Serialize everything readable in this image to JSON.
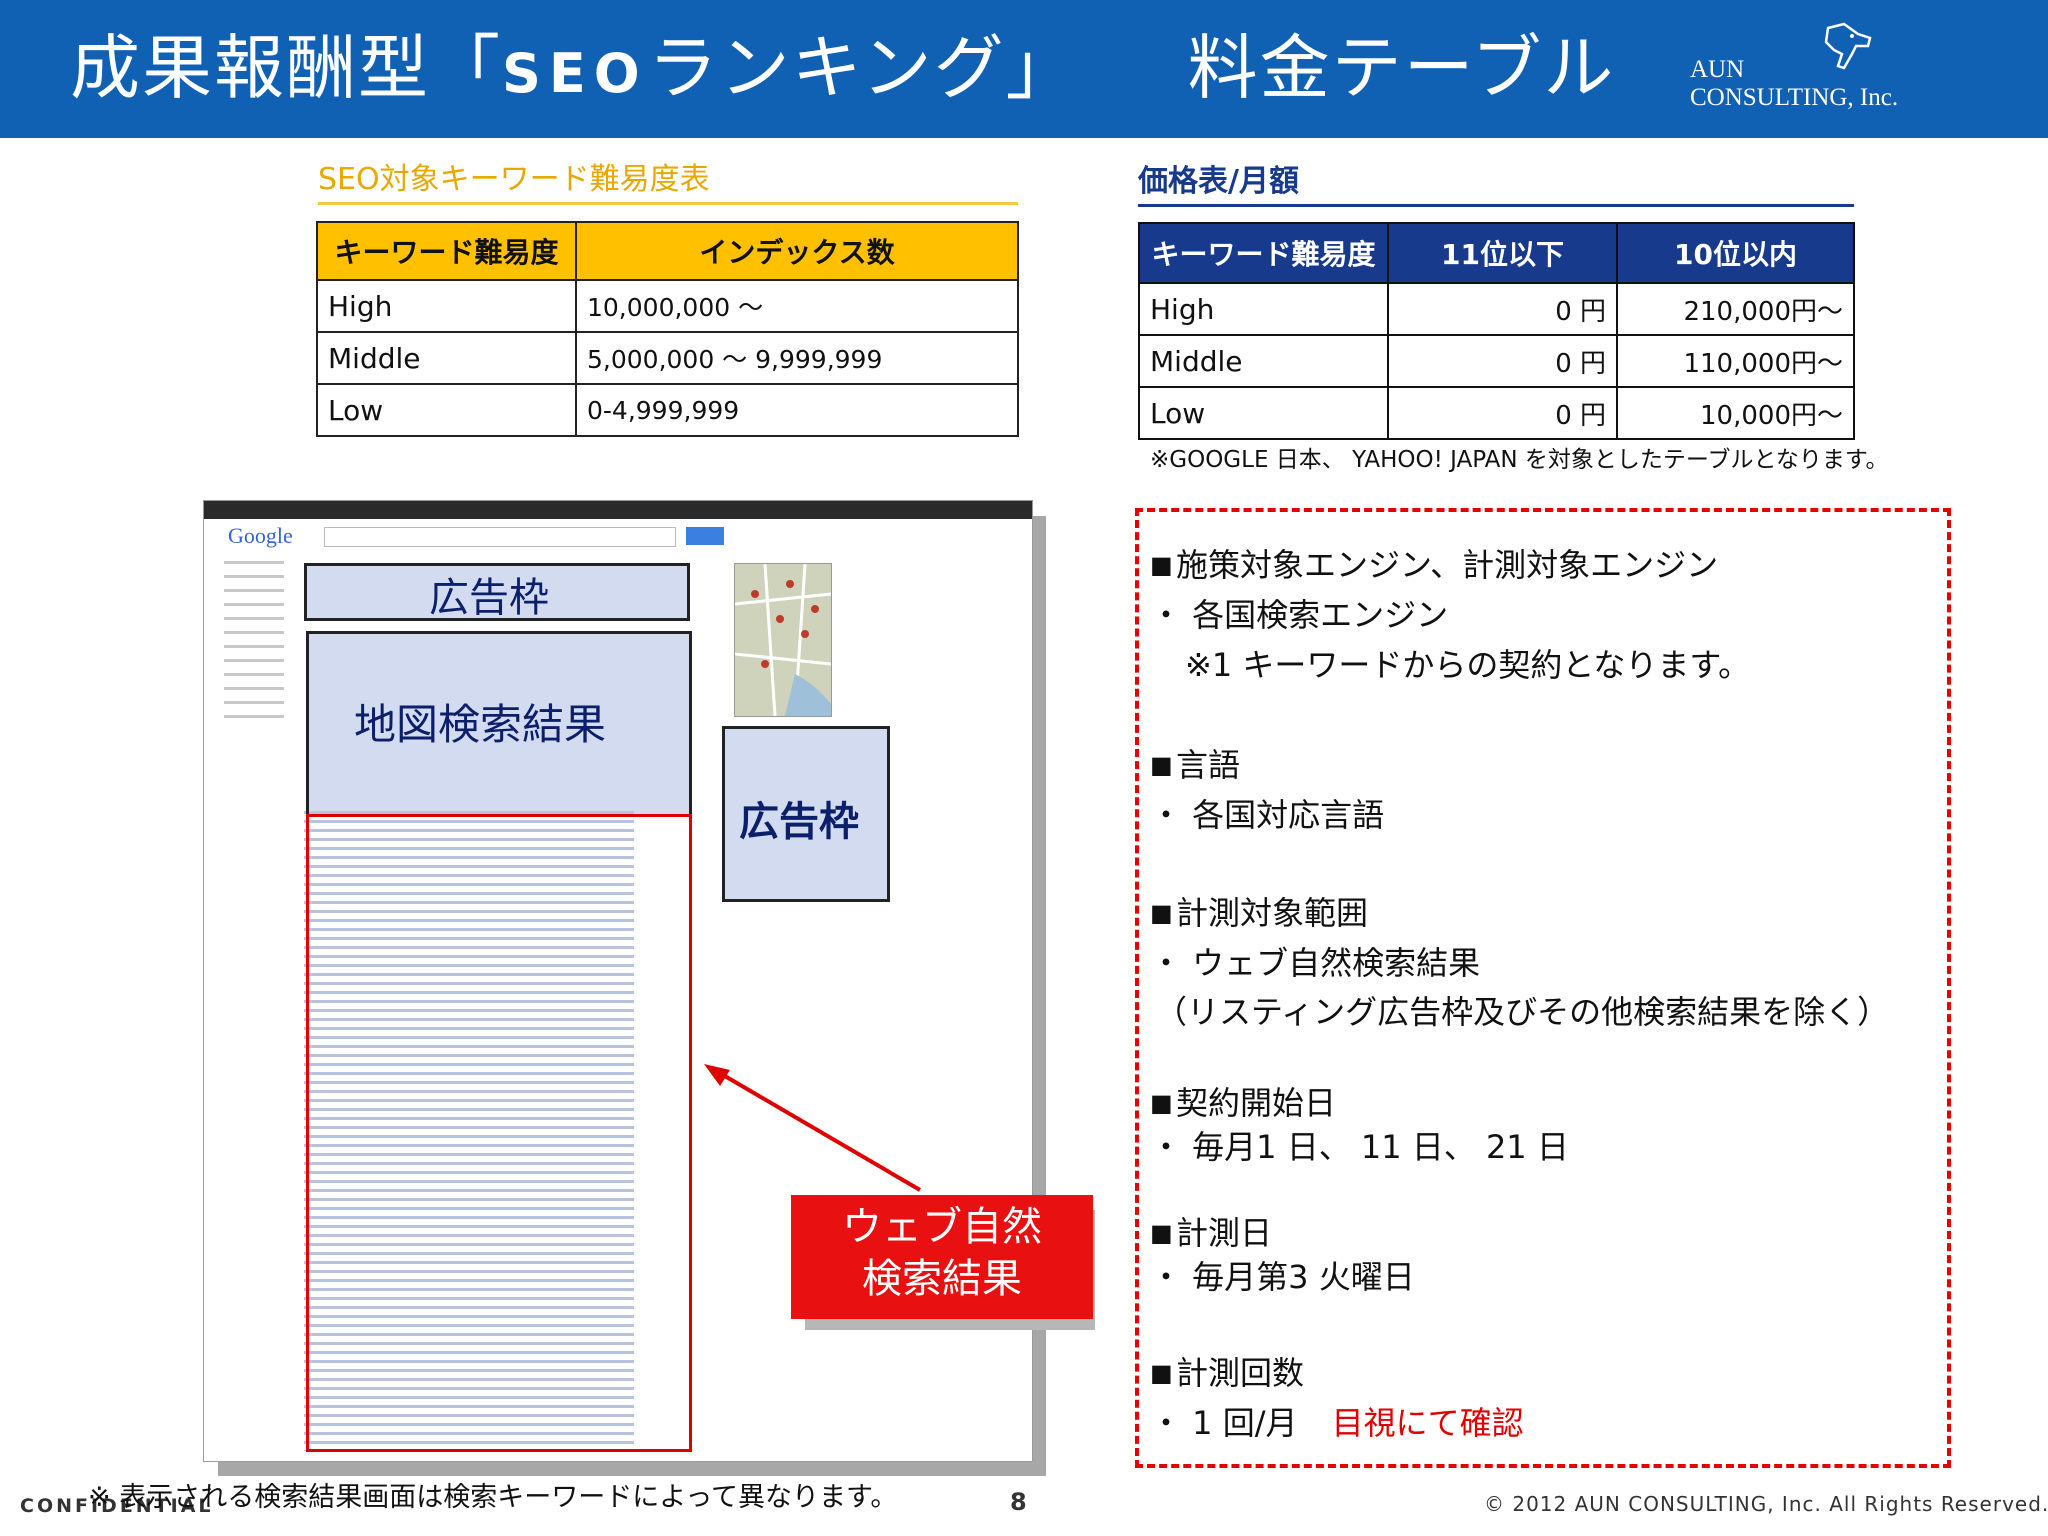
{
  "header": {
    "title_pre": "成果報酬型「",
    "title_seo": "SEO",
    "title_post": "ランキング」",
    "title_right": "料金テーブル",
    "logo_line1": "AUN",
    "logo_line2": "CONSULTING, Inc.",
    "bg_color": "#1060b4"
  },
  "keyword_table": {
    "heading": "SEO対象キーワード難易度表",
    "columns": [
      "キーワード難易度",
      "インデックス数"
    ],
    "rows": [
      [
        "High",
        "10,000,000 ～"
      ],
      [
        "Middle",
        "5,000,000 ～ 9,999,999"
      ],
      [
        "Low",
        "0-4,999,999"
      ]
    ]
  },
  "price_table": {
    "heading": "価格表/月額",
    "columns": [
      "キーワード難易度",
      "11位以下",
      "10位以内"
    ],
    "rows": [
      [
        "High",
        "0 円",
        "210,000円～"
      ],
      [
        "Middle",
        "0 円",
        "110,000円～"
      ],
      [
        "Low",
        "0 円",
        "10,000円～"
      ]
    ],
    "note": "※GOOGLE 日本、 YAHOO! JAPAN を対象としたテーブルとなります。"
  },
  "screenshot": {
    "google_logo": "Google",
    "label_ad_top": "広告枠",
    "label_map": "地図検索結果",
    "label_ad_right": "広告枠",
    "callout_line1": "ウェブ自然",
    "callout_line2": "検索結果"
  },
  "info": {
    "engine_title": "施策対象エンジン、計測対象エンジン",
    "engine_item": "・ 各国検索エンジン",
    "engine_note": "※1 キーワードからの契約となります。",
    "lang_title": "言語",
    "lang_item": "・ 各国対応言語",
    "scope_title": "計測対象範囲",
    "scope_item": "・  ウェブ自然検索結果",
    "scope_note": "（リスティング広告枠及びその他検索結果を除く）",
    "start_title": "契約開始日",
    "start_item": "・ 毎月1 日、 11 日、 21 日",
    "measure_title": "計測日",
    "measure_item": "・ 毎月第3 火曜日",
    "count_title": "計測回数",
    "count_item": "・  1 回/月",
    "count_method": "目視にて確認"
  },
  "footer": {
    "note": "※ 表示される検索結果画面は検索キーワードによって異なります。",
    "confidential": "CONFIDENTIAL",
    "page": "8",
    "copyright": "© 2012 AUN CONSULTING, Inc. All Rights Reserved."
  }
}
